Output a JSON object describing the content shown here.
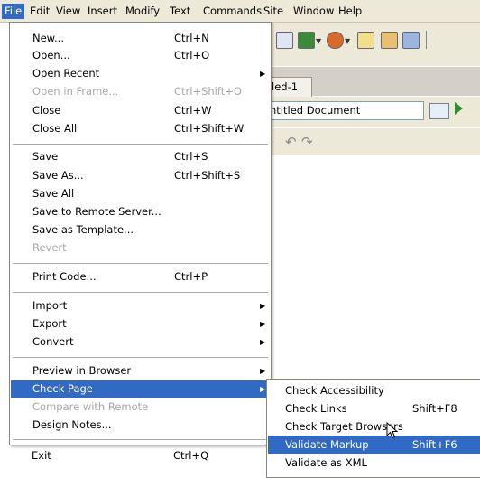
{
  "menubar": {
    "items": [
      "File",
      "Edit",
      "View",
      "Insert",
      "Modify",
      "Text",
      "Commands",
      "Site",
      "Window",
      "Help"
    ]
  },
  "document": {
    "tab_label": "led-1",
    "title_value": "ntitled Document"
  },
  "file_menu": {
    "items": [
      {
        "label": "New...",
        "shortcut": "Ctrl+N"
      },
      {
        "label": "Open...",
        "shortcut": "Ctrl+O"
      },
      {
        "label": "Open Recent",
        "submenu": true
      },
      {
        "label": "Open in Frame...",
        "shortcut": "Ctrl+Shift+O",
        "disabled": true
      },
      {
        "label": "Close",
        "shortcut": "Ctrl+W"
      },
      {
        "label": "Close All",
        "shortcut": "Ctrl+Shift+W"
      },
      {
        "label": "Save",
        "shortcut": "Ctrl+S"
      },
      {
        "label": "Save As...",
        "shortcut": "Ctrl+Shift+S"
      },
      {
        "label": "Save All"
      },
      {
        "label": "Save to Remote Server..."
      },
      {
        "label": "Save as Template..."
      },
      {
        "label": "Revert",
        "disabled": true
      },
      {
        "label": "Print Code...",
        "shortcut": "Ctrl+P"
      },
      {
        "label": "Import",
        "submenu": true
      },
      {
        "label": "Export",
        "submenu": true
      },
      {
        "label": "Convert",
        "submenu": true
      },
      {
        "label": "Preview in Browser",
        "submenu": true
      },
      {
        "label": "Check Page",
        "submenu": true,
        "highlighted": true
      },
      {
        "label": "Compare with Remote",
        "disabled": true
      },
      {
        "label": "Design Notes..."
      },
      {
        "label": "Exit",
        "shortcut": "Ctrl+Q"
      }
    ]
  },
  "check_page_submenu": {
    "items": [
      {
        "label": "Check Accessibility"
      },
      {
        "label": "Check Links",
        "shortcut": "Shift+F8"
      },
      {
        "label": "Check Target Browsers"
      },
      {
        "label": "Validate Markup",
        "shortcut": "Shift+F6",
        "highlighted": true
      },
      {
        "label": "Validate as XML"
      }
    ]
  },
  "colors": {
    "menu_bar_bg": "#ece9d8",
    "highlight": "#316ac5",
    "disabled_text": "#a7a6aa"
  }
}
